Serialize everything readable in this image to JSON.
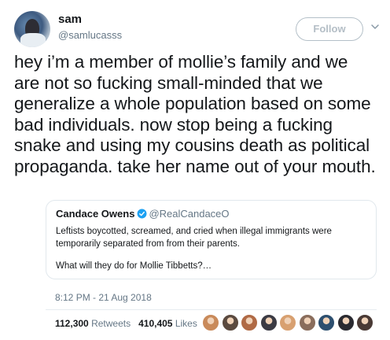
{
  "user": {
    "name": "sam",
    "handle": "@samlucasss"
  },
  "follow_label": "Follow",
  "tweet_text": "hey i’m a member of mollie’s family and we are not so fucking small-minded that we generalize a whole population based on some bad individuals. now stop being a fucking snake and using my cousins death as political propaganda. take her name out of your mouth.",
  "quoted": {
    "name": "Candace Owens",
    "handle": "@RealCandaceO",
    "paragraph1": "Leftists boycotted, screamed, and cried when illegal immigrants were temporarily separated from from their parents.",
    "paragraph2": "What will they do for Mollie Tibbetts?…"
  },
  "timestamp": "8:12 PM - 21 Aug 2018",
  "stats": {
    "retweets_count": "112,300",
    "retweets_label": "Retweets",
    "likes_count": "410,405",
    "likes_label": "Likes"
  },
  "icons": {
    "chevron": "chevron-down-icon",
    "verified": "verified-badge-icon"
  },
  "colors": {
    "secondary_text": "#657786",
    "verified_blue": "#1da1f2",
    "border": "#e1e8ed"
  },
  "liker_avatars": [
    {
      "name": "liker-1",
      "color": "#c98a5a"
    },
    {
      "name": "liker-2",
      "color": "#5b4a3f"
    },
    {
      "name": "liker-3",
      "color": "#b06a45"
    },
    {
      "name": "liker-4",
      "color": "#3b3b44"
    },
    {
      "name": "liker-5",
      "color": "#d8a070"
    },
    {
      "name": "liker-6",
      "color": "#8a6d5c"
    },
    {
      "name": "liker-7",
      "color": "#2d4f6f"
    },
    {
      "name": "liker-8",
      "color": "#2a2a30"
    },
    {
      "name": "liker-9",
      "color": "#4a3a35"
    }
  ]
}
